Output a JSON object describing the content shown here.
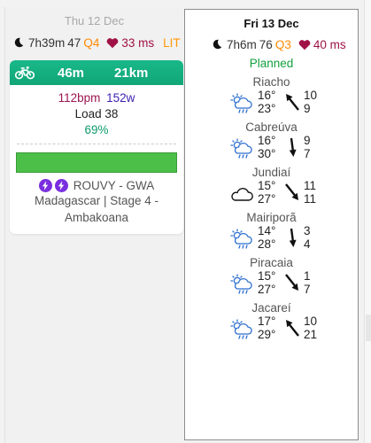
{
  "days": [
    {
      "date": "Thu 12 Dec",
      "sleep": "7h39m",
      "readiness": "47",
      "quality": "Q4",
      "hrv": "33 ms",
      "tag": "LIT",
      "workout": {
        "duration": "46m",
        "distance": "21km",
        "hr": "112bpm",
        "power": "152w",
        "load": "Load 38",
        "compliance": "69%",
        "compliance_value": 0.69,
        "source": "ROUVY - GWA",
        "description": "Madagascar | Stage 4 - Ambakoana",
        "bar_color": "#4cbf49",
        "header_color": "#19b889"
      }
    },
    {
      "date": "Fri 13 Dec",
      "sleep": "7h6m",
      "readiness": "76",
      "quality": "Q3",
      "hrv": "40 ms",
      "status": "Planned",
      "weather": [
        {
          "place": "Riacho",
          "icon": "partly-cloudy-rain-icon",
          "high": "16°",
          "low": "23°",
          "wind": "10",
          "gust": "9",
          "dir": "nw"
        },
        {
          "place": "Cabreúva",
          "icon": "partly-cloudy-rain-icon",
          "high": "16°",
          "low": "30°",
          "wind": "9",
          "gust": "7",
          "dir": "s"
        },
        {
          "place": "Jundiaí",
          "icon": "cloud-icon",
          "high": "15°",
          "low": "27°",
          "wind": "11",
          "gust": "11",
          "dir": "se"
        },
        {
          "place": "Mairiporã",
          "icon": "partly-cloudy-rain-icon",
          "high": "14°",
          "low": "28°",
          "wind": "3",
          "gust": "4",
          "dir": "s"
        },
        {
          "place": "Piracaia",
          "icon": "partly-cloudy-rain-icon",
          "high": "15°",
          "low": "27°",
          "wind": "1",
          "gust": "7",
          "dir": "se"
        },
        {
          "place": "Jacareí",
          "icon": "partly-cloudy-rain-icon",
          "high": "17°",
          "low": "29°",
          "wind": "10",
          "gust": "21",
          "dir": "nw"
        }
      ]
    }
  ],
  "colors": {
    "quality": "#ff8a00",
    "hrv": "#a01245",
    "planned": "#13a13f",
    "workout_header": "#19b889",
    "bolt": "#7a2ee0"
  }
}
